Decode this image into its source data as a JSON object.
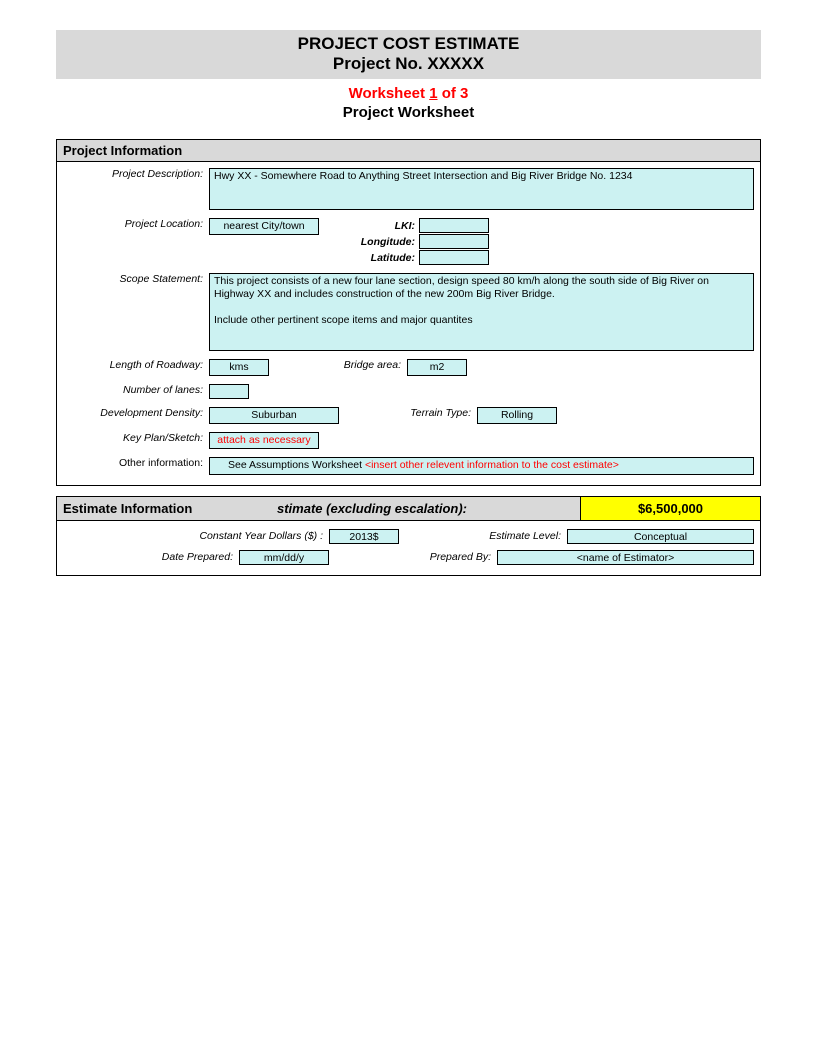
{
  "header": {
    "title1": "PROJECT COST ESTIMATE",
    "title2": "Project No. XXXXX",
    "worksheet_prefix": "Worksheet ",
    "worksheet_num": "1",
    "worksheet_suffix": " of 3",
    "subtitle": "Project Worksheet"
  },
  "project_info": {
    "section_title": "Project Information",
    "labels": {
      "description": "Project Description:",
      "location": "Project Location:",
      "lki": "LKI:",
      "longitude": "Longitude:",
      "latitude": "Latitude:",
      "scope": "Scope Statement:",
      "length": "Length of Roadway:",
      "bridge_area": "Bridge area:",
      "lanes": "Number of lanes:",
      "density": "Development Density:",
      "terrain": "Terrain Type:",
      "keyplan": "Key Plan/Sketch:",
      "other": "Other information:"
    },
    "values": {
      "description": "Hwy XX - Somewhere Road to Anything Street Intersection and Big River Bridge No. 1234",
      "location": "nearest City/town",
      "lki": "",
      "longitude": "",
      "latitude": "",
      "scope": "This project consists of a new four lane section, design speed 80 km/h along the south side of Big River on Highway XX and includes construction of the new 200m Big River Bridge.\n\nInclude other pertinent scope items and major quantites",
      "length_unit": "kms",
      "bridge_area_unit": "m2",
      "lanes": "",
      "density": "Suburban",
      "terrain": "Rolling",
      "keyplan": "attach as necessary",
      "other_prefix": "See Assumptions Worksheet ",
      "other_red": "<insert other relevent information to the cost estimate>"
    }
  },
  "estimate_info": {
    "section_title": "Estimate Information",
    "header_mid": "stimate (excluding escalation):",
    "amount": "$6,500,000",
    "labels": {
      "constant": "Constant Year Dollars ($) :",
      "level": "Estimate Level:",
      "date": "Date Prepared:",
      "prepared_by": "Prepared By:"
    },
    "values": {
      "constant": "2013$",
      "level": "Conceptual",
      "date": "mm/dd/y",
      "prepared_by": "<name of Estimator>"
    }
  }
}
